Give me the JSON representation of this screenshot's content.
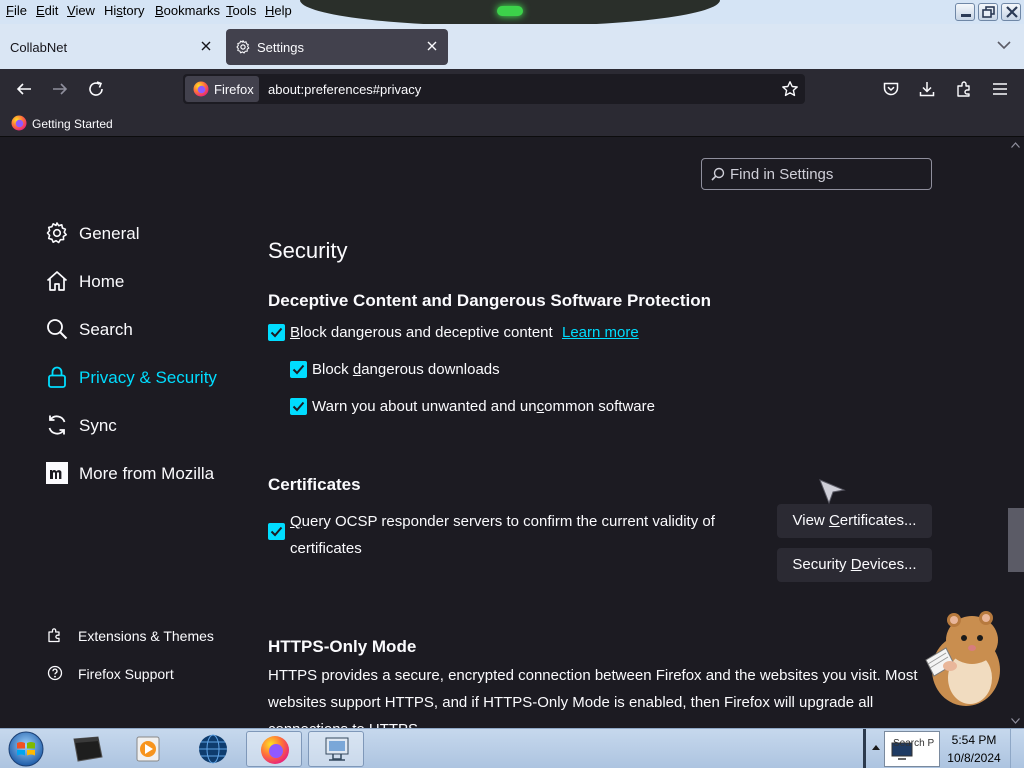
{
  "menu": {
    "file": {
      "ul": "F",
      "rest": "ile"
    },
    "edit": {
      "ul": "E",
      "rest": "dit"
    },
    "view": {
      "ul": "V",
      "rest": "iew"
    },
    "history": {
      "pre": "Hi",
      "ul": "s",
      "rest": "tory"
    },
    "bookmarks": {
      "ul": "B",
      "rest": "ookmarks"
    },
    "tools": {
      "ul": "T",
      "rest": "ools"
    },
    "help": {
      "ul": "H",
      "rest": "elp"
    }
  },
  "tabs": [
    {
      "label": "CollabNet",
      "icon": "none",
      "active": false
    },
    {
      "label": "Settings",
      "icon": "gear-icon",
      "active": true
    }
  ],
  "urlbar": {
    "identity_label": "Firefox",
    "url": "about:preferences#privacy"
  },
  "bookmarks": [
    {
      "label": "Getting Started",
      "icon": "firefox-icon"
    }
  ],
  "find": {
    "placeholder": "Find in Settings"
  },
  "categories": [
    {
      "label": "General",
      "icon": "gear-icon",
      "selected": false
    },
    {
      "label": "Home",
      "icon": "home-icon",
      "selected": false
    },
    {
      "label": "Search",
      "icon": "search-icon",
      "selected": false
    },
    {
      "label": "Privacy & Security",
      "icon": "lock-icon",
      "selected": true
    },
    {
      "label": "Sync",
      "icon": "sync-icon",
      "selected": false
    },
    {
      "label": "More from Mozilla",
      "icon": "mozilla-icon",
      "selected": false
    }
  ],
  "footer_links": [
    {
      "label": "Extensions & Themes",
      "icon": "puzzle-icon"
    },
    {
      "label": "Firefox Support",
      "icon": "help-icon"
    }
  ],
  "security": {
    "title": "Security",
    "deceptive_heading": "Deceptive Content and Dangerous Software Protection",
    "block_dangerous": {
      "ul": "B",
      "rest": "lock dangerous and deceptive content",
      "checked": true
    },
    "learn_more": "Learn more",
    "block_downloads": {
      "pre": "Block ",
      "ul": "d",
      "rest": "angerous downloads",
      "checked": true
    },
    "warn_unwanted": {
      "pre": "Warn you about unwanted and un",
      "ul": "c",
      "rest": "ommon software",
      "checked": true
    },
    "certificates_heading": "Certificates",
    "ocsp": {
      "ul": "Q",
      "rest": "uery OCSP responder servers to confirm the current validity of certificates",
      "checked": true
    },
    "view_certificates": {
      "pre": "View ",
      "ul": "C",
      "rest": "ertificates..."
    },
    "security_devices": {
      "pre": "Security ",
      "ul": "D",
      "rest": "evices..."
    },
    "https_heading": "HTTPS-Only Mode",
    "https_description": "HTTPS provides a secure, encrypted connection between Firefox and the websites you visit. Most websites support HTTPS, and if HTTPS-Only Mode is enabled, then Firefox will upgrade all connections to HTTPS."
  },
  "taskbar": {
    "tray_preview_label": "Search P",
    "clock_time": "5:54 PM",
    "clock_date": "10/8/2024"
  },
  "colors": {
    "accent": "#00ddff",
    "content_bg": "#1c1b22",
    "toolbar_bg": "#2b2a33",
    "menubar_bg": "#d5e4f5"
  }
}
